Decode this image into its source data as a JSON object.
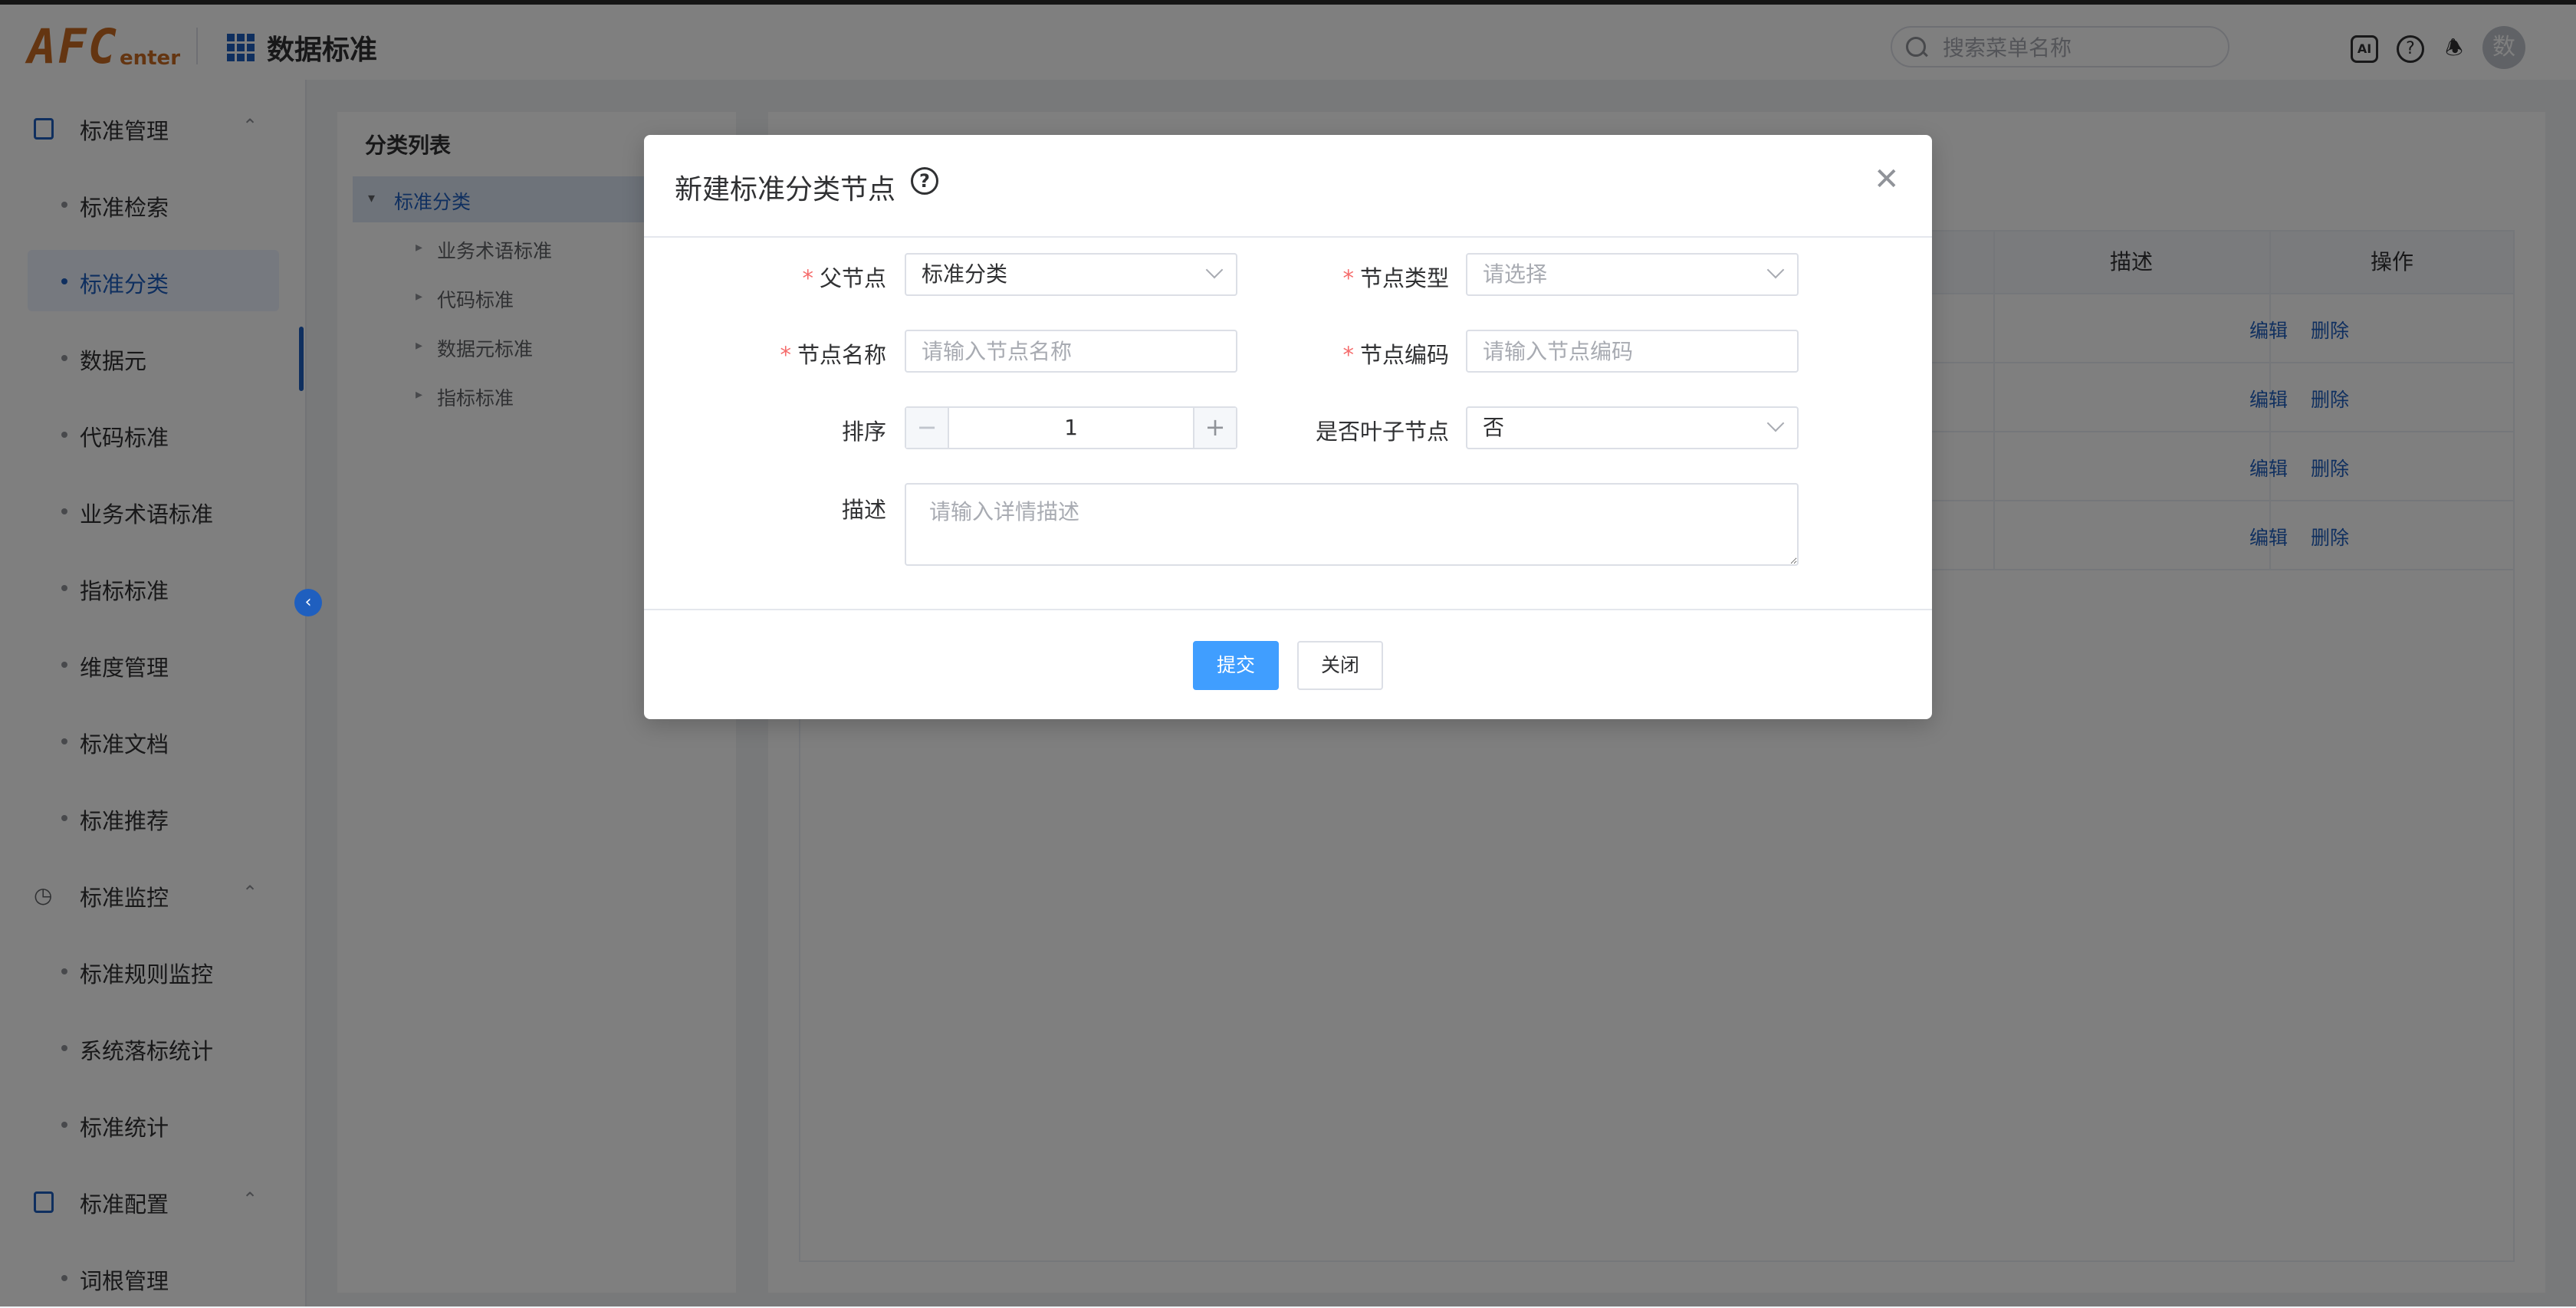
{
  "header": {
    "logo_main": "AFC",
    "logo_sub": "enter",
    "app_title": "数据标准",
    "search_placeholder": "搜索菜单名称",
    "ai_icon_label": "AI",
    "avatar_text": "数"
  },
  "sidebar": {
    "groups": [
      {
        "label": "标准管理",
        "items": [
          "标准检索",
          "标准分类",
          "数据元",
          "代码标准",
          "业务术语标准",
          "指标标准",
          "维度管理",
          "标准文档",
          "标准推荐"
        ]
      },
      {
        "label": "标准监控",
        "items": [
          "标准规则监控",
          "系统落标统计",
          "标准统计"
        ]
      },
      {
        "label": "标准配置",
        "items": [
          "词根管理"
        ]
      }
    ],
    "active_item": "标准分类"
  },
  "category_panel": {
    "title": "分类列表",
    "root": "标准分类",
    "children": [
      "业务术语标准",
      "代码标准",
      "数据元标准",
      "指标标准"
    ]
  },
  "table": {
    "columns": [
      "描述",
      "操作"
    ],
    "rows": [
      {
        "edit": "编辑",
        "delete": "删除"
      },
      {
        "edit": "编辑",
        "delete": "删除"
      },
      {
        "edit": "编辑",
        "delete": "删除"
      },
      {
        "edit": "编辑",
        "delete": "删除"
      }
    ]
  },
  "dialog": {
    "title": "新建标准分类节点",
    "fields": {
      "parent": {
        "label": "父节点",
        "value": "标准分类",
        "required": true
      },
      "type": {
        "label": "节点类型",
        "placeholder": "请选择",
        "required": true
      },
      "name": {
        "label": "节点名称",
        "placeholder": "请输入节点名称",
        "required": true
      },
      "code": {
        "label": "节点编码",
        "placeholder": "请输入节点编码",
        "required": true
      },
      "sort": {
        "label": "排序",
        "value": "1"
      },
      "leaf": {
        "label": "是否叶子节点",
        "value": "否"
      },
      "desc": {
        "label": "描述",
        "placeholder": "请输入详情描述"
      }
    },
    "required_mark": "*",
    "submit_label": "提交",
    "close_label": "关闭"
  },
  "colors": {
    "primary": "#409eff",
    "brand_blue": "#1f5fbf",
    "logo_orange": "#c96a22",
    "required": "#f56c6c"
  }
}
